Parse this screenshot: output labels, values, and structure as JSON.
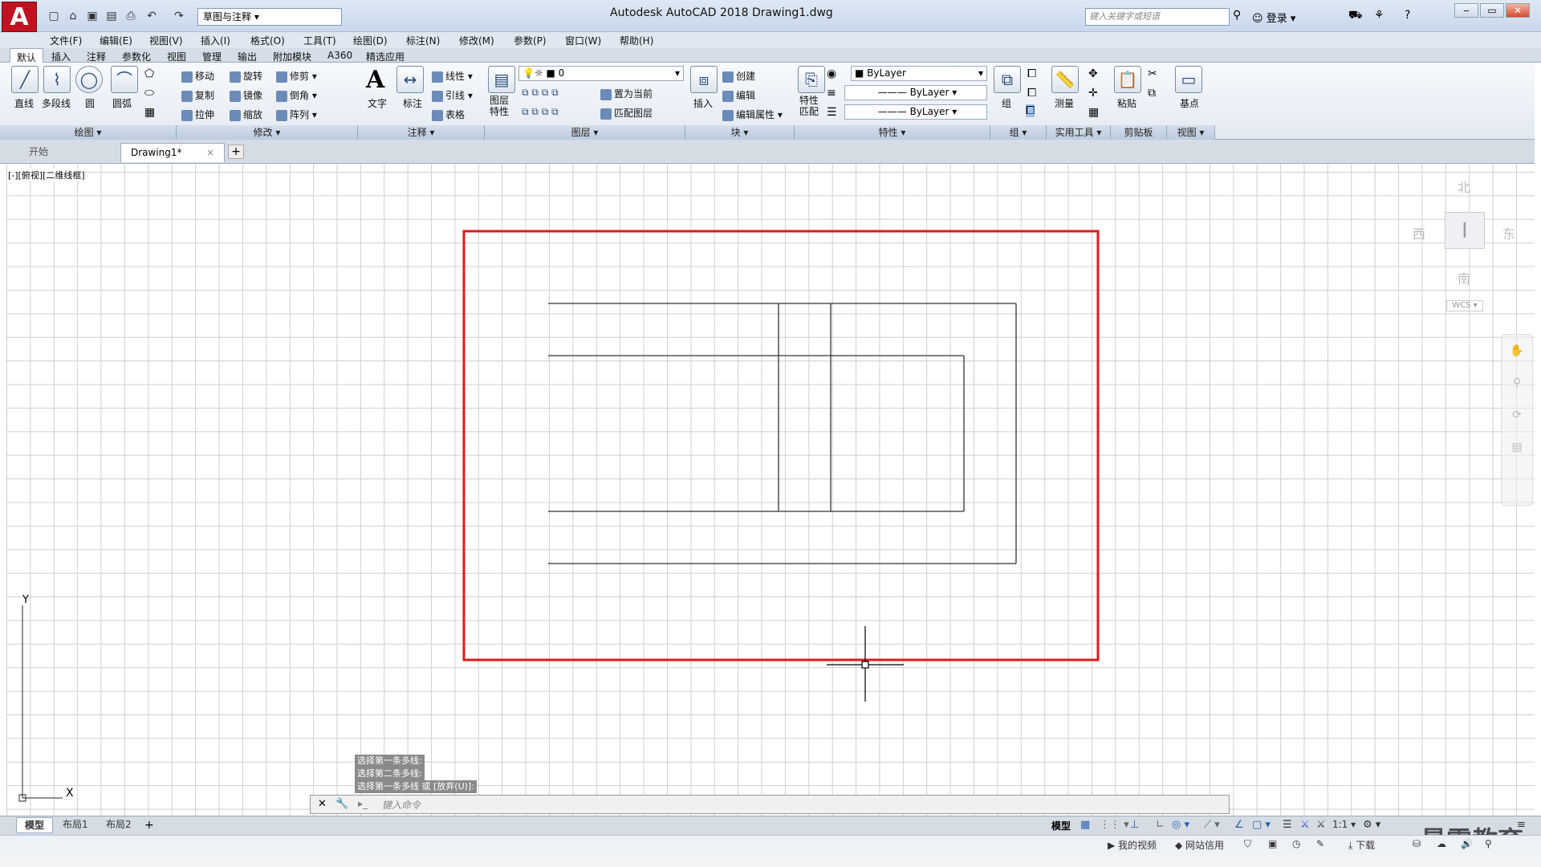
{
  "titlebar": {
    "workspace": "草图与注释",
    "title": "Autodesk AutoCAD 2018    Drawing1.dwg",
    "search_placeholder": "键入关键字或短语",
    "login": "登录"
  },
  "menu": [
    "文件(F)",
    "编辑(E)",
    "视图(V)",
    "插入(I)",
    "格式(O)",
    "工具(T)",
    "绘图(D)",
    "标注(N)",
    "修改(M)",
    "参数(P)",
    "窗口(W)",
    "帮助(H)"
  ],
  "ribbon_tabs": [
    "默认",
    "插入",
    "注释",
    "参数化",
    "视图",
    "管理",
    "输出",
    "附加模块",
    "A360",
    "精选应用"
  ],
  "ribbon": {
    "draw": {
      "line": "直线",
      "polyline": "多段线",
      "circle": "圆",
      "arc": "圆弧",
      "panel": "绘图"
    },
    "modify": {
      "move": "移动",
      "rotate": "旋转",
      "trim": "修剪",
      "copy": "复制",
      "mirror": "镜像",
      "fillet": "倒角",
      "stretch": "拉伸",
      "scale": "缩放",
      "array": "阵列",
      "panel": "修改"
    },
    "annotation": {
      "text": "文字",
      "dimension": "标注",
      "linear": "线性",
      "leader": "引线",
      "table": "表格",
      "panel": "注释"
    },
    "layers": {
      "layer_props": "图层特性",
      "current_layer": "0",
      "make_current": "置为当前",
      "match_layer": "匹配图层",
      "panel": "图层"
    },
    "block": {
      "insert": "插入",
      "create": "创建",
      "edit": "编辑",
      "edit_attr": "编辑属性",
      "panel": "块"
    },
    "properties": {
      "match": "特性匹配",
      "color": "ByLayer",
      "linetype": "ByLayer",
      "lineweight": "ByLayer",
      "panel": "特性"
    },
    "groups": {
      "group": "组",
      "panel": "组"
    },
    "utilities": {
      "measure": "测量",
      "panel": "实用工具"
    },
    "clipboard": {
      "paste": "粘贴",
      "panel": "剪贴板"
    },
    "view": {
      "base": "基点",
      "panel": "视图"
    }
  },
  "doc_tabs": [
    "开始",
    "Drawing1*"
  ],
  "viewport_label": "[-][俯视][二维线框]",
  "viewcube": {
    "north": "北",
    "south": "南",
    "east": "东",
    "west": "西",
    "wcs": "WCS"
  },
  "command_history": [
    "选择第一条多线:",
    "选择第二条多线:",
    "选择第一条多线 或 [放弃(U)]:"
  ],
  "command_placeholder": "键入命令",
  "layout_tabs": [
    "模型",
    "布局1",
    "布局2"
  ],
  "status": {
    "model": "模型",
    "scale": "1:1"
  },
  "bottom_bar": [
    "我的视频",
    "网站信用",
    "下载"
  ],
  "watermark": "最需教育",
  "ucs": {
    "x": "X",
    "y": "Y"
  }
}
